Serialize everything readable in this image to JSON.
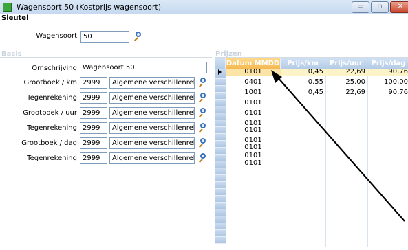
{
  "window": {
    "title": "Wagensoort 50 (Kostprijs wagensoort)",
    "minimize_glyph": "▭",
    "maximize_glyph": "▫",
    "close_glyph": "✕",
    "icon_color": "#3aa53a"
  },
  "sleutel": {
    "section_label": "Sleutel",
    "wagensoort_label": "Wagensoort",
    "wagensoort_value": "50"
  },
  "basis": {
    "section_label": "Basis",
    "omschrijving_label": "Omschrijving",
    "omschrijving_value": "Wagensoort 50",
    "rekeningen": [
      {
        "label": "Grootboek / km",
        "code": "2999",
        "desc": "Algemene verschillenrekenir"
      },
      {
        "label": "Tegenrekening",
        "code": "2999",
        "desc": "Algemene verschillenrekenir"
      },
      {
        "label": "Grootboek / uur",
        "code": "2999",
        "desc": "Algemene verschillenrekenir"
      },
      {
        "label": "Tegenrekening",
        "code": "2999",
        "desc": "Algemene verschillenrekenir"
      },
      {
        "label": "Grootboek / dag",
        "code": "2999",
        "desc": "Algemene verschillenrekenir"
      },
      {
        "label": "Tegenrekening",
        "code": "2999",
        "desc": "Algemene verschillenrekenir"
      }
    ]
  },
  "prijzen": {
    "section_label": "Prijzen",
    "columns": [
      "Datum MMDD",
      "Prijs/km",
      "Prijs/uur",
      "Prijs/dag"
    ],
    "rows": [
      {
        "date": "0101",
        "km": "0,45",
        "uur": "22,69",
        "dag": "90,76"
      },
      {
        "date": "0401",
        "km": "0,55",
        "uur": "25,00",
        "dag": "100,00"
      },
      {
        "date": "1001",
        "km": "0,45",
        "uur": "22,69",
        "dag": "90,76"
      },
      {
        "date": "0101",
        "km": "",
        "uur": "",
        "dag": ""
      },
      {
        "date": "0101",
        "km": "",
        "uur": "",
        "dag": ""
      },
      {
        "date": "0101",
        "km": "",
        "uur": "",
        "dag": ""
      },
      {
        "date": "0101",
        "km": "",
        "uur": "",
        "dag": ""
      },
      {
        "date": "0101",
        "km": "",
        "uur": "",
        "dag": ""
      },
      {
        "date": "0101",
        "km": "",
        "uur": "",
        "dag": ""
      },
      {
        "date": "0101",
        "km": "",
        "uur": "",
        "dag": ""
      },
      {
        "date": "0101",
        "km": "",
        "uur": "",
        "dag": ""
      },
      {
        "date": "0101",
        "km": "",
        "uur": "",
        "dag": ""
      },
      {
        "date": "0101",
        "km": "",
        "uur": "",
        "dag": ""
      }
    ]
  },
  "icons": {
    "lookup": "search-icon",
    "row_pointer": "current-row-arrow-icon",
    "annotation": "annotation-arrow"
  }
}
